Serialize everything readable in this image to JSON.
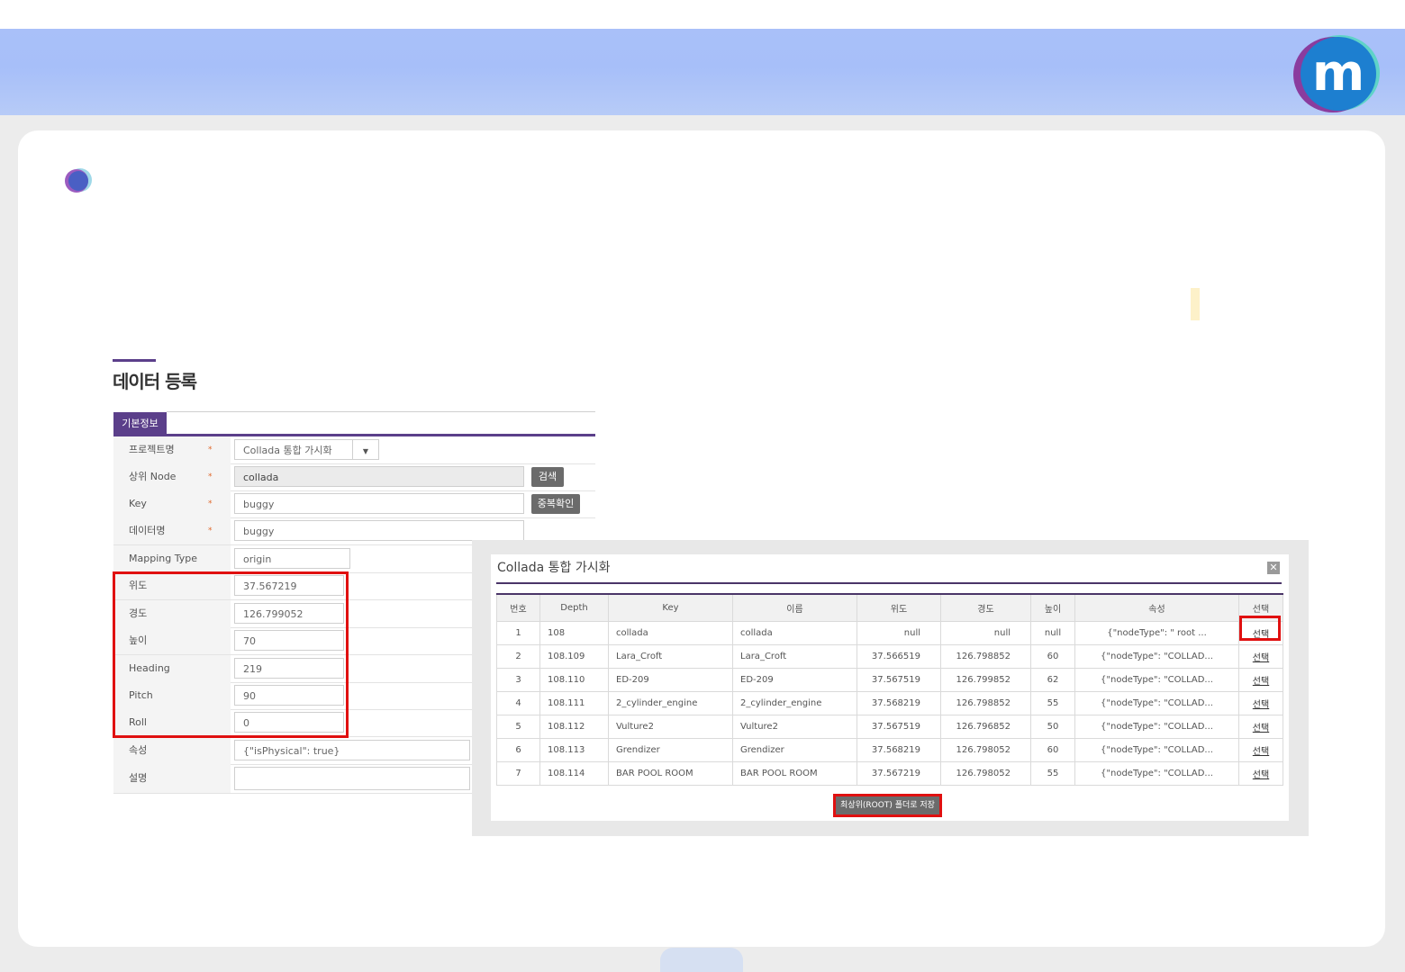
{
  "form": {
    "title": "데이터 등록",
    "tab": "기본정보",
    "fields": [
      {
        "label": "프로젝트명",
        "value": "Collada 통합 가시화",
        "required": "*"
      },
      {
        "label": "상위 Node",
        "value": "collada",
        "required": "*"
      },
      {
        "label": "Key",
        "value": "buggy",
        "required": "*"
      },
      {
        "label": "데이터명",
        "value": "buggy",
        "required": "*"
      },
      {
        "label": "Mapping Type",
        "value": "origin"
      },
      {
        "label": "위도",
        "value": "37.567219"
      },
      {
        "label": "경도",
        "value": "126.799052"
      },
      {
        "label": "높이",
        "value": "70"
      },
      {
        "label": "Heading",
        "value": "219"
      },
      {
        "label": "Pitch",
        "value": "90"
      },
      {
        "label": "Roll",
        "value": "0"
      },
      {
        "label": "속성",
        "value": "{\"isPhysical\": true}"
      },
      {
        "label": "설명",
        "value": ""
      }
    ],
    "search_button": "검색",
    "dup_check_button": "중복확인"
  },
  "popup": {
    "title": "Collada 통합 가시화",
    "close": "✕",
    "columns": [
      "번호",
      "Depth",
      "Key",
      "이름",
      "위도",
      "경도",
      "높이",
      "속성",
      "선택"
    ],
    "rows": [
      [
        "1",
        "108",
        "collada",
        "collada",
        "null",
        "null",
        "null",
        "{\"nodeType\": \" root ...",
        "선택"
      ],
      [
        "2",
        "108.109",
        "Lara_Croft",
        "Lara_Croft",
        "37.566519",
        "126.798852",
        "60",
        "{\"nodeType\": \"COLLAD...",
        "선택"
      ],
      [
        "3",
        "108.110",
        "ED-209",
        "ED-209",
        "37.567519",
        "126.799852",
        "62",
        "{\"nodeType\": \"COLLAD...",
        "선택"
      ],
      [
        "4",
        "108.111",
        "2_cylinder_engine",
        "2_cylinder_engine",
        "37.568219",
        "126.798852",
        "55",
        "{\"nodeType\": \"COLLAD...",
        "선택"
      ],
      [
        "5",
        "108.112",
        "Vulture2",
        "Vulture2",
        "37.567519",
        "126.796852",
        "50",
        "{\"nodeType\": \"COLLAD...",
        "선택"
      ],
      [
        "6",
        "108.113",
        "Grendizer",
        "Grendizer",
        "37.568219",
        "126.798052",
        "60",
        "{\"nodeType\": \"COLLAD...",
        "선택"
      ],
      [
        "7",
        "108.114",
        "BAR POOL ROOM",
        "BAR POOL ROOM",
        "37.567219",
        "126.798052",
        "55",
        "{\"nodeType\": \"COLLAD...",
        "선택"
      ]
    ],
    "save_button": "최상위(ROOT) 폴더로 저장"
  },
  "colors": {
    "banner": "#a9c0f9",
    "accent": "#5b3f8a",
    "highlight": "#e01010"
  },
  "icons": {
    "logo": "m-logo-icon",
    "bullet": "circle-bullet-icon",
    "close": "close-icon",
    "dropdown": "chevron-down-icon"
  }
}
